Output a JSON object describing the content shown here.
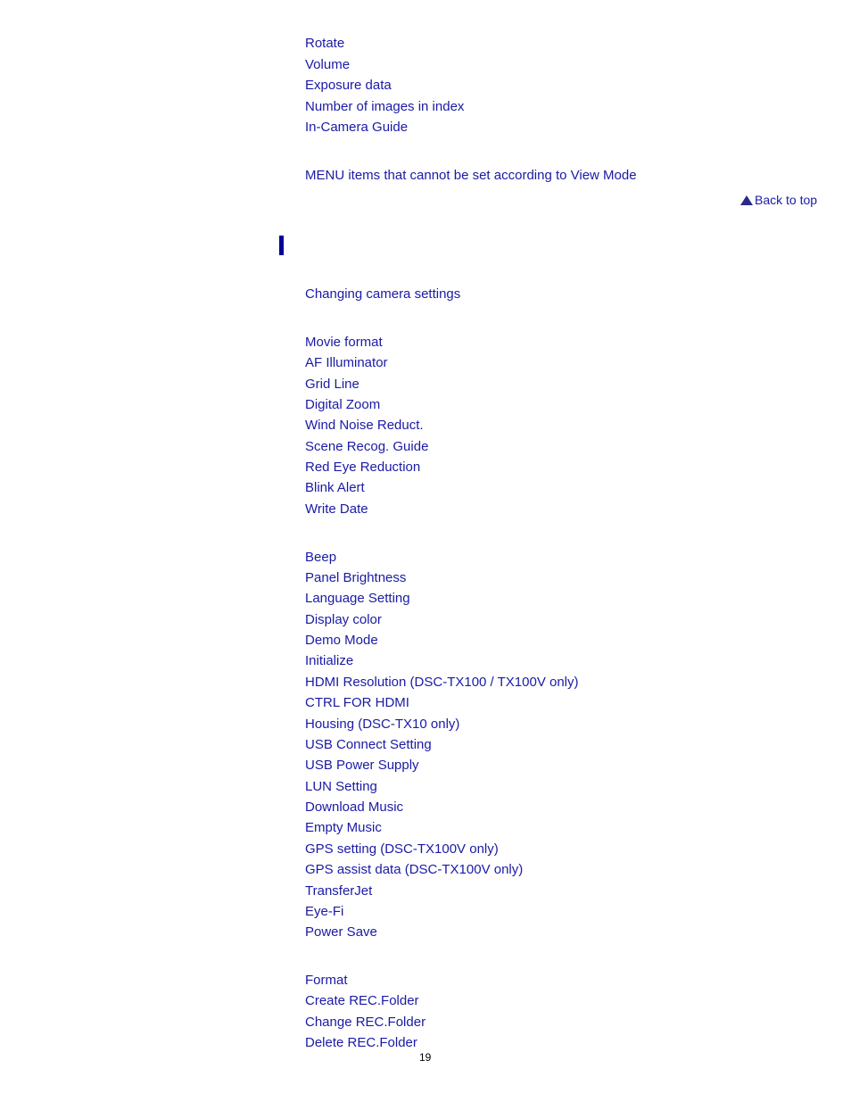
{
  "top_links": [
    "Rotate",
    "Volume",
    "Exposure data",
    "Number of images in index",
    "In-Camera Guide"
  ],
  "view_mode_link": "MENU items that cannot be set according to View Mode",
  "back_to_top": "Back to top",
  "section": {
    "intro_link": "Changing camera settings",
    "shooting_settings": [
      "Movie format",
      "AF Illuminator",
      "Grid Line",
      "Digital Zoom",
      "Wind Noise Reduct.",
      "Scene Recog. Guide",
      "Red Eye Reduction",
      "Blink Alert",
      "Write Date"
    ],
    "main_settings": [
      "Beep",
      "Panel Brightness",
      "Language Setting",
      "Display color",
      "Demo Mode",
      "Initialize",
      "HDMI Resolution (DSC-TX100 / TX100V only)",
      "CTRL FOR HDMI",
      "Housing (DSC-TX10 only)",
      "USB Connect Setting",
      "USB Power Supply",
      "LUN Setting",
      "Download Music",
      "Empty Music",
      "GPS setting (DSC-TX100V only)",
      "GPS assist data (DSC-TX100V only)",
      "TransferJet",
      "Eye-Fi",
      "Power Save"
    ],
    "memory_tool": [
      "Format",
      "Create REC.Folder",
      "Change REC.Folder",
      "Delete REC.Folder"
    ]
  },
  "page_number": "19",
  "colors": {
    "link": "#1a1aa6",
    "heading_bar": "#000099"
  }
}
